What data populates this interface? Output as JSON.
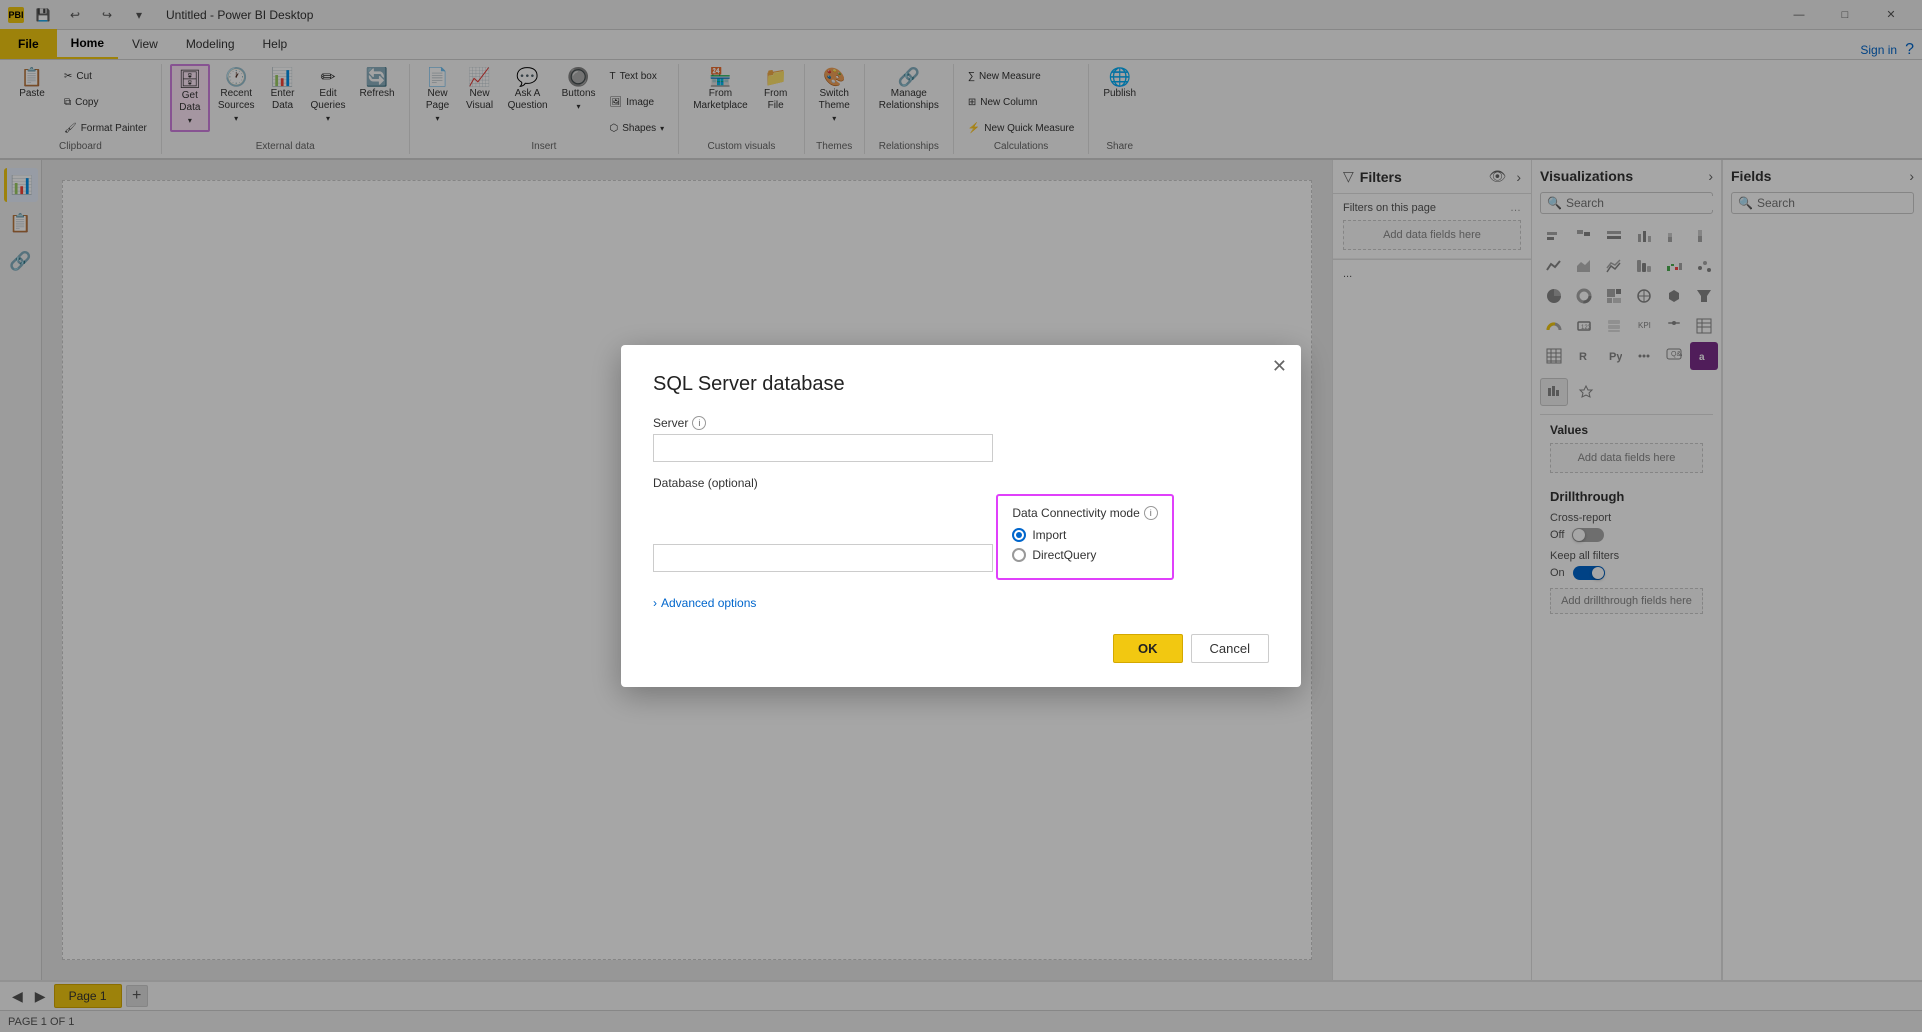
{
  "app": {
    "title": "Untitled - Power BI Desktop",
    "logo_label": "PBI"
  },
  "titlebar": {
    "qat": [
      "💾",
      "↩",
      "↪",
      "▾"
    ],
    "win_controls": [
      "—",
      "□",
      "✕"
    ]
  },
  "ribbon_tabs": {
    "file": "File",
    "home": "Home",
    "view": "View",
    "modeling": "Modeling",
    "help": "Help"
  },
  "ribbon": {
    "clipboard_label": "Clipboard",
    "external_data_label": "External data",
    "insert_label": "Insert",
    "custom_visuals_label": "Custom visuals",
    "themes_label": "Themes",
    "relationships_label": "Relationships",
    "calculations_label": "Calculations",
    "share_label": "Share",
    "buttons": {
      "paste": "Paste",
      "cut": "Cut",
      "copy": "Copy",
      "format_painter": "Format Painter",
      "get_data": "Get\nData",
      "recent_sources": "Recent\nSources",
      "enter_data": "Enter\nData",
      "edit_queries": "Edit\nQueries",
      "refresh": "Refresh",
      "new_page": "New\nPage",
      "new_visual": "New\nVisual",
      "ask_question": "Ask A\nQuestion",
      "buttons": "Buttons",
      "text_box": "Text box",
      "image": "Image",
      "shapes": "Shapes",
      "from_marketplace": "From\nMarketplace",
      "from_file": "From\nFile",
      "switch_theme": "Switch\nTheme",
      "manage_relationships": "Manage\nRelationships",
      "new_measure": "New Measure",
      "new_column": "New Column",
      "new_quick_measure": "New Quick Measure",
      "publish": "Publish"
    }
  },
  "filters": {
    "title": "Filters",
    "filters_on_page": "Filters on this page",
    "add_fields_text": "Add data fields here"
  },
  "visualizations": {
    "title": "Visualizations",
    "search_placeholder": "Search",
    "values_title": "Values",
    "values_add_text": "Add data fields here",
    "drillthrough_title": "Drillthrough",
    "cross_report_label": "Cross-report",
    "cross_report_state": "Off",
    "keep_filters_label": "Keep all filters",
    "keep_filters_state": "On",
    "add_drillthrough_text": "Add drillthrough fields here"
  },
  "fields": {
    "title": "Fields"
  },
  "page_tabs": {
    "page1": "Page 1",
    "add_label": "+"
  },
  "status_bar": {
    "text": "PAGE 1 OF 1"
  },
  "modal": {
    "title": "SQL Server database",
    "server_label": "Server",
    "database_label": "Database (optional)",
    "connectivity_label": "Data Connectivity mode",
    "import_label": "Import",
    "direct_query_label": "DirectQuery",
    "advanced_label": "Advanced options",
    "ok_label": "OK",
    "cancel_label": "Cancel"
  }
}
